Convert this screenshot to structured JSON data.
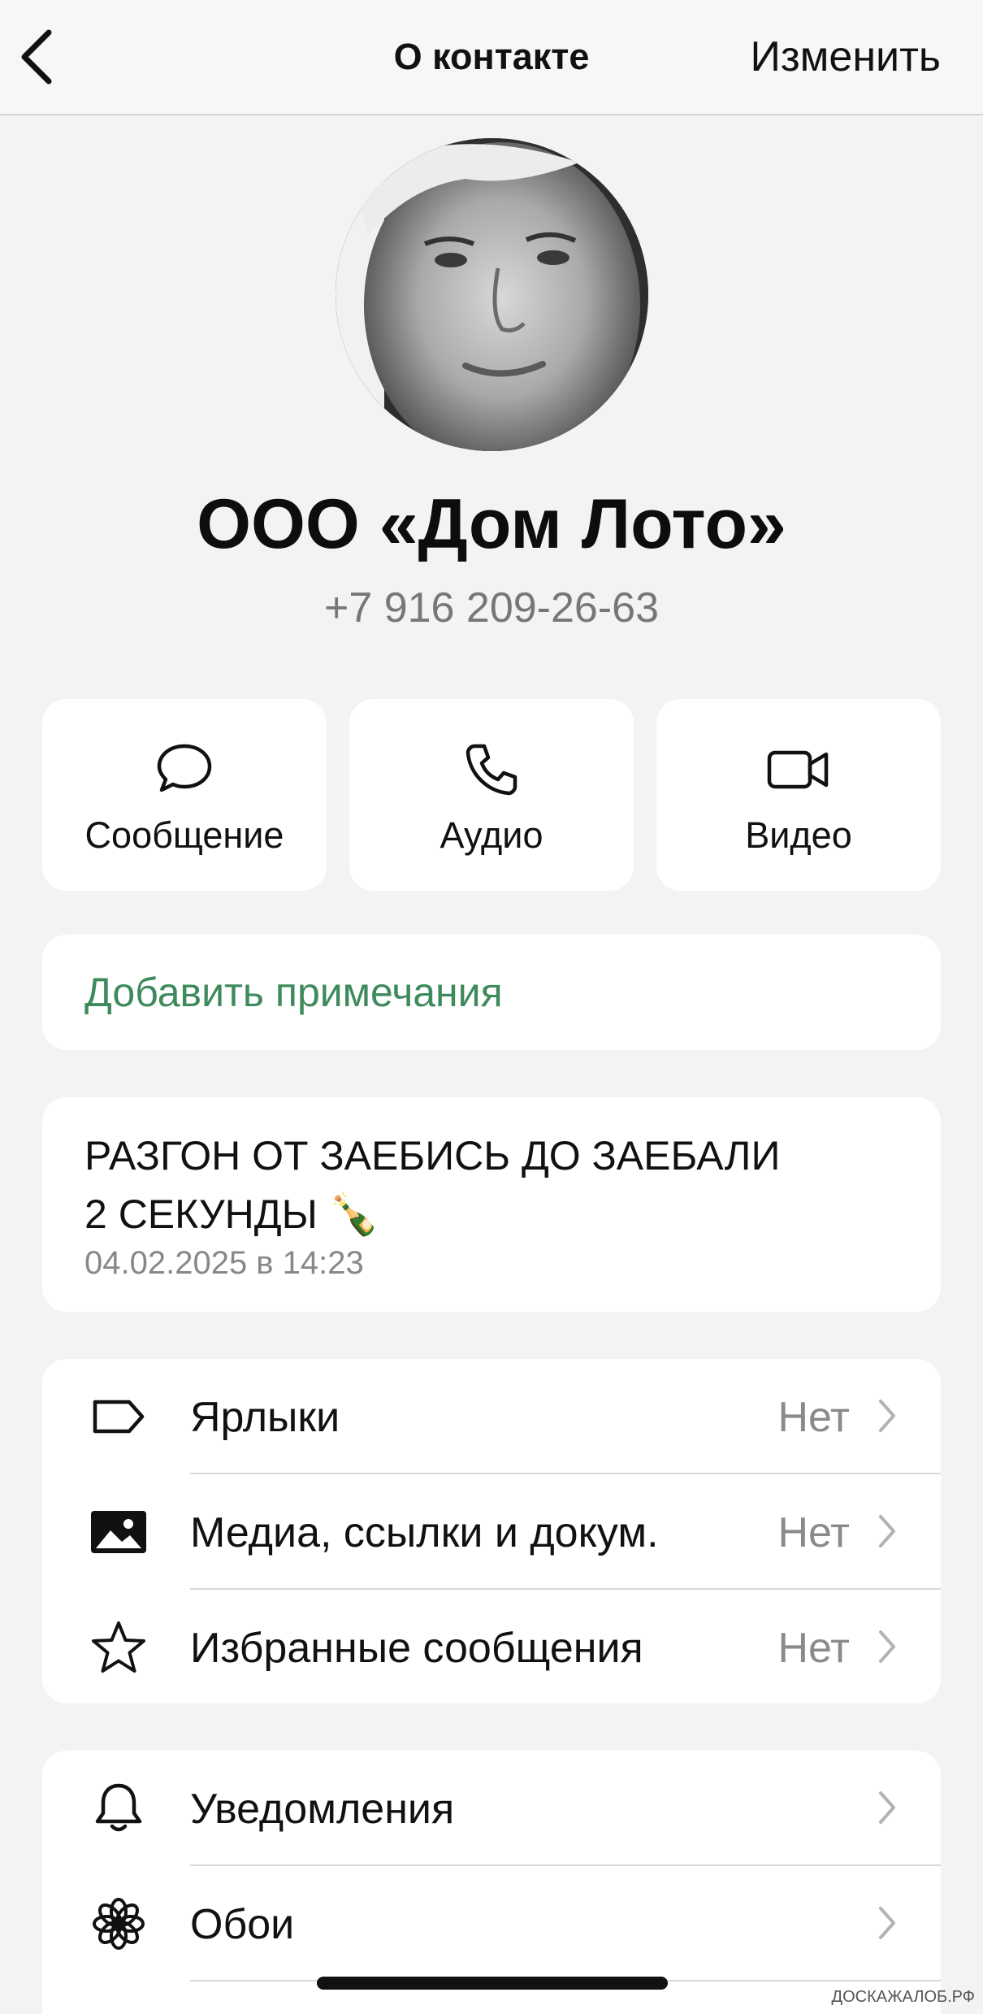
{
  "header": {
    "title": "О контакте",
    "edit_label": "Изменить",
    "back_icon": "chevron-left-icon"
  },
  "contact": {
    "name": "ООО «Дом Лото»",
    "phone": "+7 916 209-26-63"
  },
  "actions": [
    {
      "label": "Сообщение",
      "icon": "chat-bubble-icon"
    },
    {
      "label": "Аудио",
      "icon": "phone-icon"
    },
    {
      "label": "Видео",
      "icon": "video-camera-icon"
    }
  ],
  "notes": {
    "label": "Добавить примечания",
    "color": "#3f8a5c"
  },
  "about": {
    "line1": "РАЗГОН ОТ ЗАЕБИСЬ ДО ЗАЕБАЛИ",
    "line2": "2 СЕКУНДЫ 🍾",
    "date": "04.02.2025 в 14:23"
  },
  "list1": [
    {
      "label": "Ярлыки",
      "value": "Нет",
      "icon": "label-tag-icon"
    },
    {
      "label": "Медиа, ссылки и докум.",
      "value": "Нет",
      "icon": "image-icon"
    },
    {
      "label": "Избранные сообщения",
      "value": "Нет",
      "icon": "star-icon"
    }
  ],
  "list2": [
    {
      "label": "Уведомления",
      "icon": "bell-icon"
    },
    {
      "label": "Обои",
      "icon": "flower-icon"
    }
  ],
  "watermark": "ДОСКАЖАЛОБ.РФ"
}
